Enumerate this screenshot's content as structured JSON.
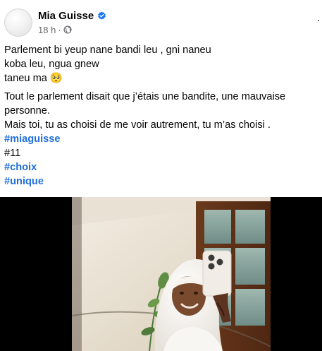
{
  "post": {
    "author": "Mia Guisse",
    "time": "18 h",
    "separator": "·",
    "more_label": "···",
    "lines": [
      "Parlement bi yeup nane bandi leu , gni naneu",
      "koba leu, ngua gnew",
      "taneu ma 🥺"
    ],
    "body": [
      "Tout le parlement disait que j’étais une bandite, une mauvaise",
      "personne.",
      "Mais toi, tu as choisi de me voir autrement, tu m’as choisi ."
    ],
    "hashtag_1": "#miaguisse",
    "number_tag": "#11",
    "hashtag_2": "#choix",
    "hashtag_3": "#unique"
  },
  "colors": {
    "verified": "#1877f2",
    "hashtag": "#216fdb",
    "meta": "#65676b"
  },
  "icons": {
    "verified": "verified-badge-icon",
    "privacy": "globe-icon"
  }
}
